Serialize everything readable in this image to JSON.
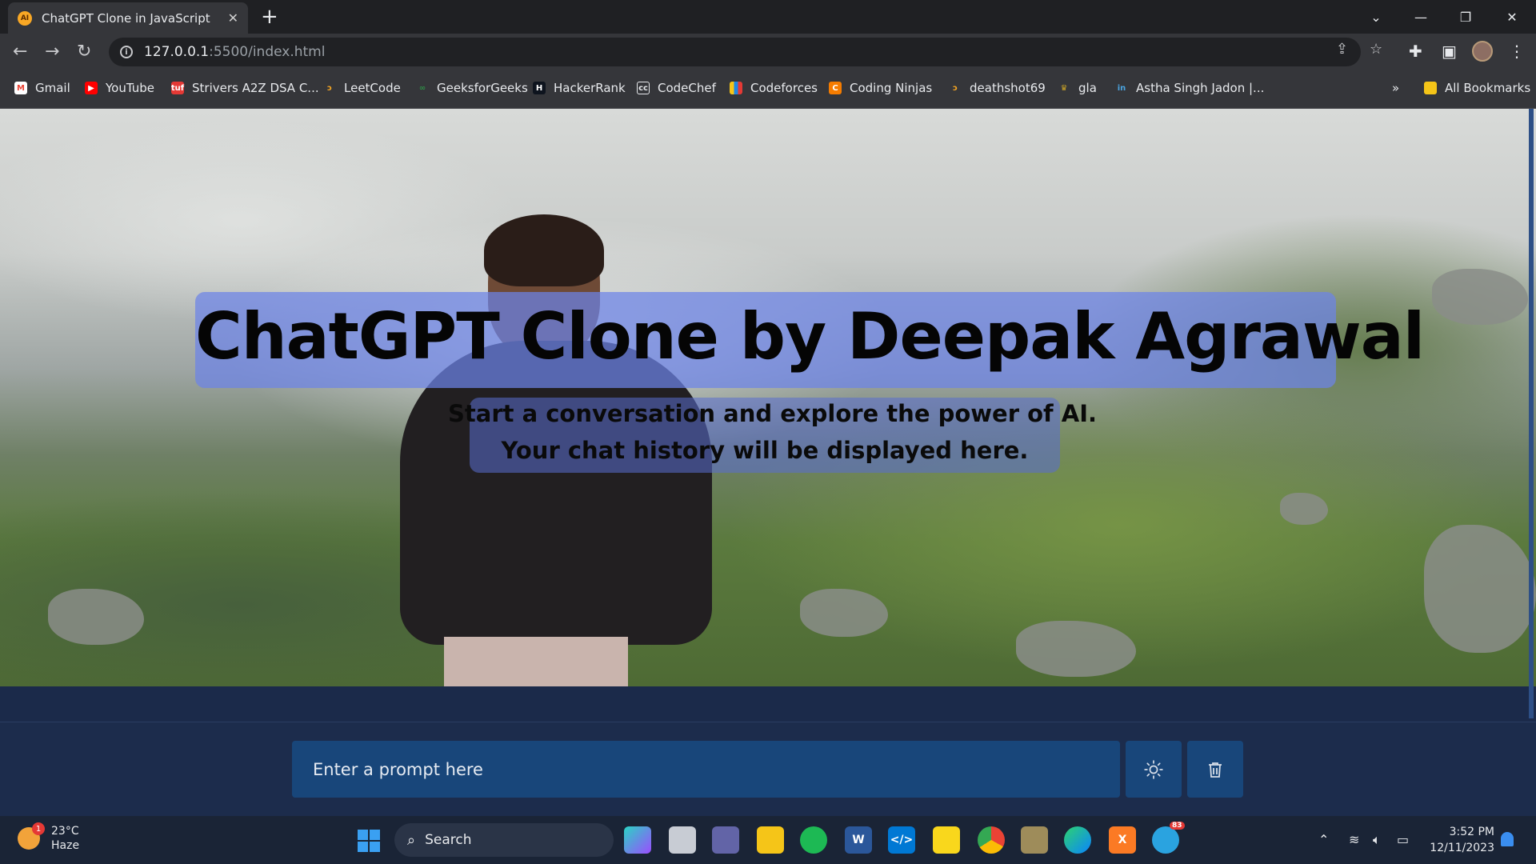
{
  "browser": {
    "tab_title": "ChatGPT Clone in JavaScript",
    "url_host": "127.0.0.1",
    "url_path": ":5500/index.html",
    "bookmarks": [
      {
        "label": "Gmail",
        "icon": "gmail-icon"
      },
      {
        "label": "YouTube",
        "icon": "youtube-icon"
      },
      {
        "label": "Strivers A2Z DSA C...",
        "icon": "takeuforward-icon"
      },
      {
        "label": "LeetCode",
        "icon": "leetcode-icon"
      },
      {
        "label": "GeeksforGeeks",
        "icon": "geeksforgeeks-icon"
      },
      {
        "label": "HackerRank",
        "icon": "hackerrank-icon"
      },
      {
        "label": "CodeChef",
        "icon": "codechef-icon"
      },
      {
        "label": "Codeforces",
        "icon": "codeforces-icon"
      },
      {
        "label": "Coding Ninjas",
        "icon": "codingninjas-icon"
      },
      {
        "label": "deathshot69",
        "icon": "leetcode-icon"
      },
      {
        "label": "gla",
        "icon": "gla-icon"
      },
      {
        "label": "Astha Singh Jadon |...",
        "icon": "linkedin-icon"
      }
    ],
    "overflow_label": "»",
    "all_bookmarks_label": "All Bookmarks"
  },
  "hero": {
    "title": "ChatGPT Clone by Deepak Agrawal",
    "subtitle_line1": "Start a conversation and explore the power of AI.",
    "subtitle_line2": "Your chat history will be displayed here."
  },
  "prompt": {
    "placeholder": "Enter a prompt here",
    "theme_button_icon": "sun-icon",
    "delete_button_icon": "trash-icon"
  },
  "taskbar": {
    "weather_temp": "23°C",
    "weather_desc": "Haze",
    "weather_badge": "1",
    "search_label": "Search",
    "telegram_badge": "83",
    "time": "3:52 PM",
    "date": "12/11/2023"
  },
  "colors": {
    "page_bg": "#1b2a4a",
    "prompt_bg": "#18467a",
    "headline_highlight": "#6c84e8"
  }
}
